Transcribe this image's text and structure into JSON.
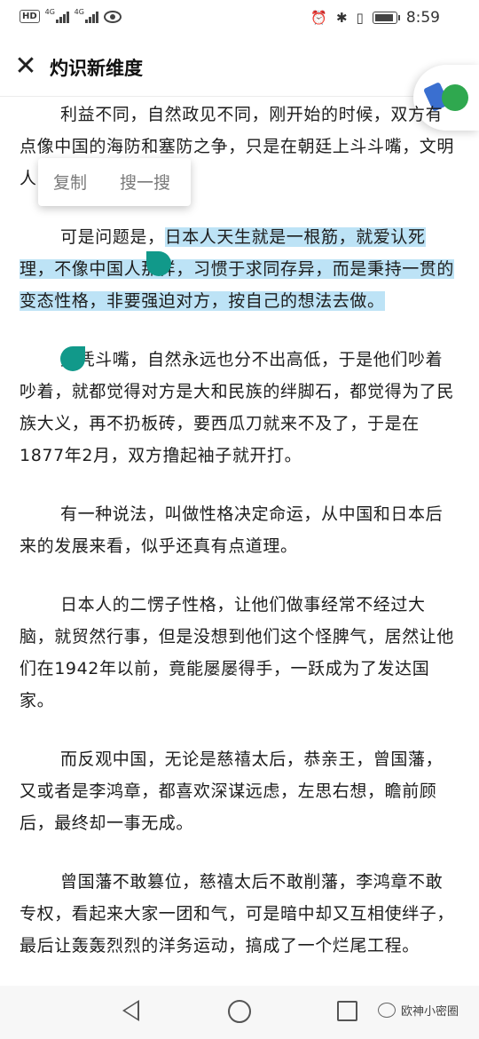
{
  "status_bar": {
    "hd": "HD",
    "signal1_label": "4G",
    "signal2_label": "4G",
    "time": "8:59",
    "battery_level": 0.9
  },
  "header": {
    "title": "灼识新维度"
  },
  "context_menu": {
    "copy": "复制",
    "search": "搜一搜"
  },
  "article": {
    "paragraphs": [
      {
        "before": "利益不同，自然政见不同，刚开始的时候，双方有点像中国的海防和塞防之争，只是在朝廷上斗斗嘴，文明人的方式来解决。",
        "highlight": "",
        "after": ""
      },
      {
        "before": "可是问题是，",
        "highlight": "日本人天生就是一根筋，就爱认死理，不像中国人那样，习惯于求同存异，而是秉持一贯的变态性格，非要强迫对方，按自己的想法去做。",
        "after": ""
      },
      {
        "before": "光凭斗嘴，自然永远也分不出高低，于是他们吵着吵着，就都觉得对方是大和民族的绊脚石，都觉得为了民族大义，再不扔板砖，要西瓜刀就来不及了，于是在1877年2月，双方撸起袖子就开打。",
        "highlight": "",
        "after": ""
      },
      {
        "before": "有一种说法，叫做性格决定命运，从中国和日本后来的发展来看，似乎还真有点道理。",
        "highlight": "",
        "after": ""
      },
      {
        "before": "日本人的二愣子性格，让他们做事经常不经过大脑，就贸然行事，但是没想到他们这个怪脾气，居然让他们在1942年以前，竟能屡屡得手，一跃成为了发达国家。",
        "highlight": "",
        "after": ""
      },
      {
        "before": "而反观中国，无论是慈禧太后，恭亲王，曾国藩，又或者是李鸿章，都喜欢深谋远虑，左思右想，瞻前顾后，最终却一事无成。",
        "highlight": "",
        "after": ""
      },
      {
        "before": "曾国藩不敢篡位，慈禧太后不敢削藩，李鸿章不敢专权，看起来大家一团和气，可是暗中却又互相使绊子，最后让轰轰烈烈的洋务运动，搞成了一个烂尾工程。",
        "highlight": "",
        "after": ""
      }
    ]
  },
  "nav_bar": {
    "watermark": "欧神小密圈"
  }
}
